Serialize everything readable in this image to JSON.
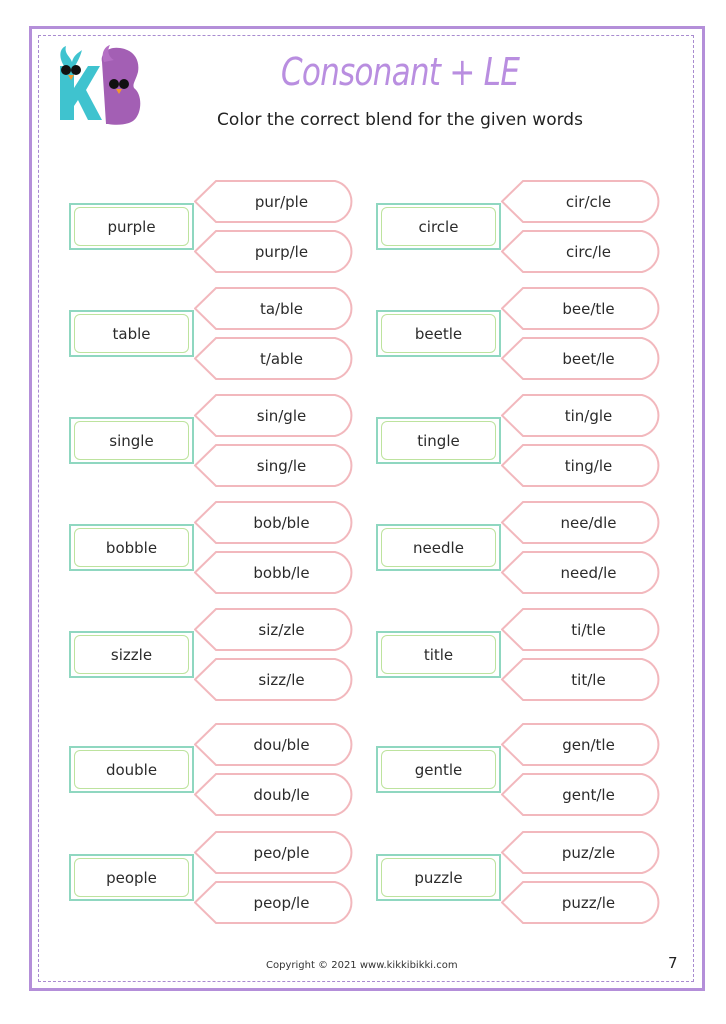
{
  "header": {
    "logo_icon": "kb-monster-logo-icon",
    "title": "Consonant + LE",
    "subtitle": "Color the correct blend for the given words"
  },
  "colors": {
    "frame": "#b48fd9",
    "title": "#b98ee0",
    "word_box_outer": "#8fd7c0",
    "word_box_inner": "#bde39e",
    "option_border": "#f2b8bd",
    "logo_k": "#3fc3cf",
    "logo_b": "#a35fb4"
  },
  "pairs": [
    {
      "word": "purple",
      "options": [
        "pur/ple",
        "purp/le"
      ]
    },
    {
      "word": "circle",
      "options": [
        "cir/cle",
        "circ/le"
      ]
    },
    {
      "word": "table",
      "options": [
        "ta/ble",
        "t/able"
      ]
    },
    {
      "word": "beetle",
      "options": [
        "bee/tle",
        "beet/le"
      ]
    },
    {
      "word": "single",
      "options": [
        "sin/gle",
        "sing/le"
      ]
    },
    {
      "word": "tingle",
      "options": [
        "tin/gle",
        "ting/le"
      ]
    },
    {
      "word": "bobble",
      "options": [
        "bob/ble",
        "bobb/le"
      ]
    },
    {
      "word": "needle",
      "options": [
        "nee/dle",
        "need/le"
      ]
    },
    {
      "word": "sizzle",
      "options": [
        "siz/zle",
        "sizz/le"
      ]
    },
    {
      "word": "title",
      "options": [
        "ti/tle",
        "tit/le"
      ]
    },
    {
      "word": "double",
      "options": [
        "dou/ble",
        "doub/le"
      ]
    },
    {
      "word": "gentle",
      "options": [
        "gen/tle",
        "gent/le"
      ]
    },
    {
      "word": "people",
      "options": [
        "peo/ple",
        "peop/le"
      ]
    },
    {
      "word": "puzzle",
      "options": [
        "puz/zle",
        "puzz/le"
      ]
    }
  ],
  "footer": {
    "copyright": "Copyright © 2021 www.kikkibikki.com",
    "page_number": "7"
  }
}
